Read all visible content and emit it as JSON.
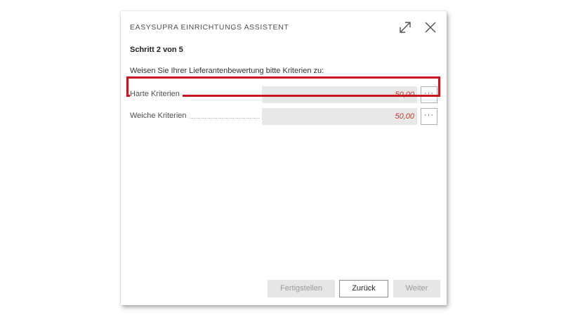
{
  "dialog": {
    "title": "EASYSUPRA EINRICHTUNGS ASSISTENT",
    "step": "Schritt 2 von 5",
    "instruction": "Weisen Sie Ihrer Lieferantenbewertung bitte Kriterien zu:",
    "icons": {
      "expand": "expand-icon",
      "close": "close-icon"
    }
  },
  "fields": [
    {
      "label": "Harte Kriterien",
      "value": "50,00",
      "more": "···"
    },
    {
      "label": "Weiche Kriterien",
      "value": "50,00",
      "more": "···"
    }
  ],
  "buttons": {
    "finish": "Fertigstellen",
    "back": "Zurück",
    "next": "Weiter"
  },
  "colors": {
    "value_text": "#c0392b",
    "highlight": "#c8141e",
    "field_bg": "#e8e8e8"
  }
}
